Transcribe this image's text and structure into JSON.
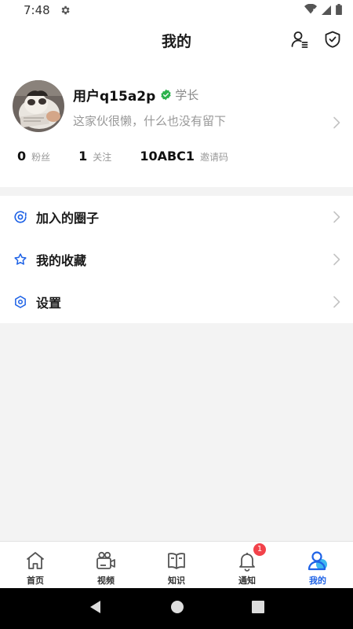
{
  "status_bar": {
    "time": "7:48"
  },
  "header": {
    "title": "我的"
  },
  "profile": {
    "username": "用户q15a2p",
    "role": "学长",
    "bio": "这家伙很懒，什么也没有留下",
    "stats": [
      {
        "value": "0",
        "label": "粉丝"
      },
      {
        "value": "1",
        "label": "关注"
      },
      {
        "value": "10ABC1",
        "label": "邀请码"
      }
    ]
  },
  "menu": {
    "items": [
      {
        "label": "加入的圈子",
        "icon": "circle-icon"
      },
      {
        "label": "我的收藏",
        "icon": "star-icon"
      },
      {
        "label": "设置",
        "icon": "settings-icon"
      }
    ]
  },
  "tabbar": {
    "tabs": [
      {
        "label": "首页",
        "icon": "home-icon"
      },
      {
        "label": "视频",
        "icon": "video-icon"
      },
      {
        "label": "知识",
        "icon": "book-icon"
      },
      {
        "label": "通知",
        "icon": "bell-icon",
        "badge": "1"
      },
      {
        "label": "我的",
        "icon": "profile-icon",
        "active": true
      }
    ]
  },
  "colors": {
    "accent": "#1e62e6",
    "badge": "#f2424a",
    "verified": "#2bb24c"
  }
}
